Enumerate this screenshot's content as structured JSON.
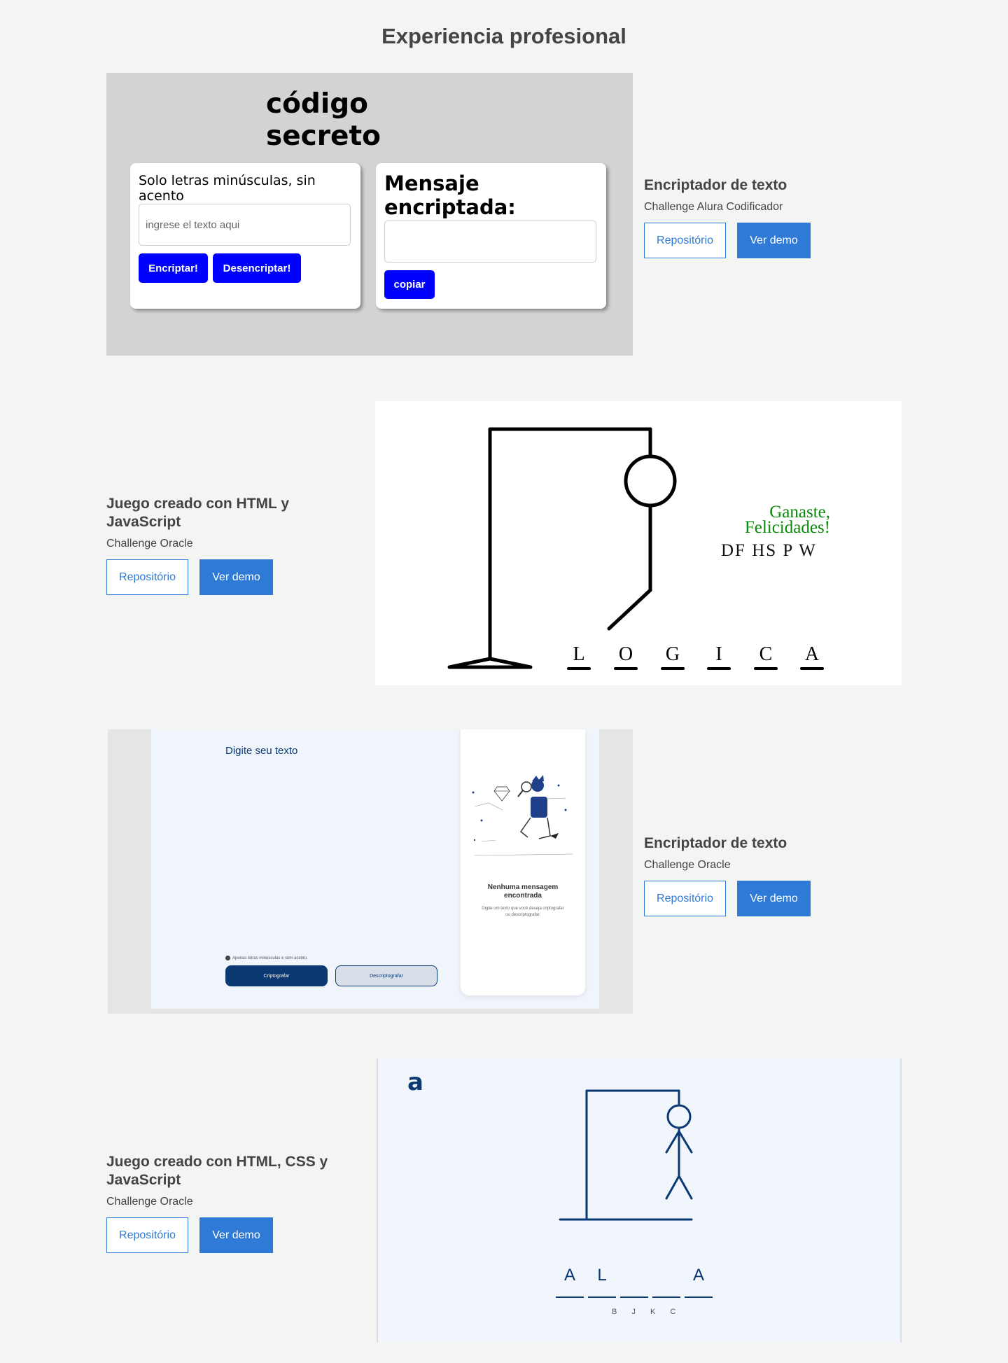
{
  "section": {
    "title": "Experiencia profesional"
  },
  "buttons": {
    "repo": "Repositório",
    "demo": "Ver demo"
  },
  "projects": [
    {
      "title": "Encriptador de texto",
      "subtitle": "Challenge Alura Codificador"
    },
    {
      "title": "Juego creado con HTML y JavaScript",
      "subtitle": "Challenge Oracle"
    },
    {
      "title": "Encriptador de texto",
      "subtitle": "Challenge Oracle"
    },
    {
      "title": "Juego creado con HTML, CSS y JavaScript",
      "subtitle": "Challenge Oracle"
    }
  ],
  "preview1": {
    "title": "código\nsecreto",
    "input_label": "Solo letras minúsculas, sin acento",
    "input_placeholder": "ingrese el texto aqui",
    "encrypt": "Encriptar!",
    "decrypt": "Desencriptar!",
    "output_label": "Mensaje\nencriptada:",
    "copy": "copiar",
    "bg_color": "#d3d3d3",
    "button_color": "#0000ff"
  },
  "preview2": {
    "win_message": "Ganaste,\nFelicidades!",
    "wrong_letters": "DF HS P W",
    "word_letters": [
      "L",
      "O",
      "G",
      "I",
      "C",
      "A"
    ],
    "win_color": "#0a8a0a"
  },
  "preview3": {
    "placeholder": "Digite seu texto",
    "note": "Apenas letras minúsculas e sem acento.",
    "encrypt": "Criptografar",
    "decrypt": "Descriptografar",
    "no_message": "Nenhuma mensagem\nencontrada",
    "description": "Digite um texto que você deseja criptografar ou descriptografar.",
    "accent": "#0a3871"
  },
  "preview4": {
    "logo": "a",
    "word_letters": [
      "A",
      "L",
      "",
      "",
      "A"
    ],
    "wrong_letters": "B J K C",
    "accent": "#0a3871"
  }
}
